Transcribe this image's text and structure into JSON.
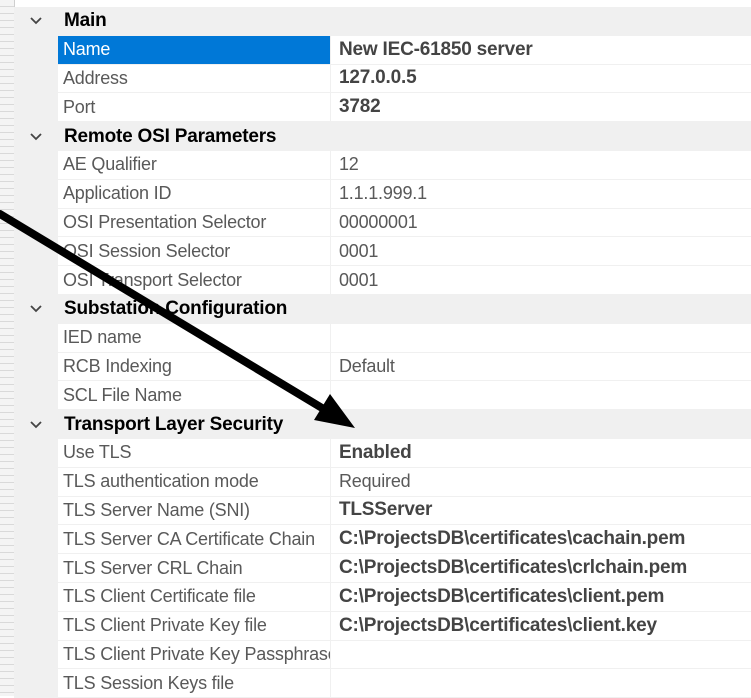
{
  "categories": [
    {
      "label": "Main",
      "rows": [
        {
          "name": "Name",
          "value": "New IEC-61850 server",
          "bold": true,
          "selected": true
        },
        {
          "name": "Address",
          "value": "127.0.0.5",
          "bold": true
        },
        {
          "name": "Port",
          "value": "3782",
          "bold": true
        }
      ]
    },
    {
      "label": "Remote OSI Parameters",
      "rows": [
        {
          "name": "AE Qualifier",
          "value": "12"
        },
        {
          "name": "Application ID",
          "value": "1.1.1.999.1"
        },
        {
          "name": "OSI Presentation Selector",
          "value": "00000001"
        },
        {
          "name": "OSI Session Selector",
          "value": "0001"
        },
        {
          "name": "OSI Transport Selector",
          "value": "0001"
        }
      ]
    },
    {
      "label": "Substation Configuration",
      "rows": [
        {
          "name": "IED name",
          "value": ""
        },
        {
          "name": "RCB Indexing",
          "value": "Default"
        },
        {
          "name": "SCL File Name",
          "value": ""
        }
      ]
    },
    {
      "label": "Transport Layer Security",
      "rows": [
        {
          "name": "Use TLS",
          "value": "Enabled",
          "bold": true
        },
        {
          "name": "TLS authentication mode",
          "value": "Required"
        },
        {
          "name": "TLS Server Name (SNI)",
          "value": "TLSServer",
          "bold": true
        },
        {
          "name": "TLS Server CA Certificate Chain",
          "value": "C:\\ProjectsDB\\certificates\\cachain.pem",
          "bold": true
        },
        {
          "name": "TLS Server CRL Chain",
          "value": "C:\\ProjectsDB\\certificates\\crlchain.pem",
          "bold": true
        },
        {
          "name": "TLS Client Certificate file",
          "value": "C:\\ProjectsDB\\certificates\\client.pem",
          "bold": true
        },
        {
          "name": "TLS Client Private Key file",
          "value": "C:\\ProjectsDB\\certificates\\client.key",
          "bold": true
        },
        {
          "name": "TLS Client Private Key Passphrase",
          "value": ""
        },
        {
          "name": "TLS Session Keys file",
          "value": ""
        }
      ]
    }
  ],
  "icons": {
    "expander": "chevron-down-icon",
    "annotation": "arrow-annotation"
  },
  "colors": {
    "selection": "#0078d7",
    "gutter": "#f0f0f0",
    "arrow": "#000000"
  }
}
